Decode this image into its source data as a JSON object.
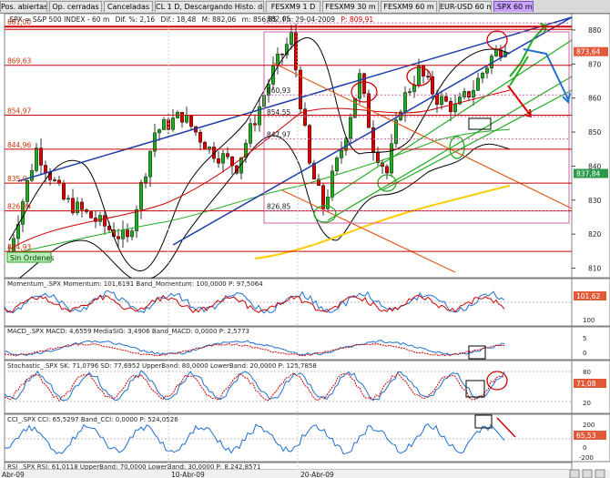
{
  "tabs": [
    "Pos. abiertas",
    "Op. cerradas",
    "Canceladas",
    "CL 1 D, Descargando Histo. de [CL]",
    "FESXM9 1 D",
    "FESXM9 30 m",
    "FESXM9 60 m",
    "EUR-USD 60 m",
    ".SPX 60 m"
  ],
  "main_header": {
    "symbol": ".SPX = S&P 500 INDEX - 60 m",
    "dif": "Dif. %: 2,16",
    "dif_abs": "Dif.: 18,48",
    "max": "M: 882,06",
    "min": "m: 856,85",
    "fecha": "Fh: 29-04-2009",
    "precio": "P: 809,91"
  },
  "price_labels": [
    {
      "text": "881,00",
      "value": 881,
      "color": "#cc0000"
    },
    {
      "text": "869,63",
      "value": 869.63,
      "color": "#cc0000"
    },
    {
      "text": "854,97",
      "value": 854.97,
      "color": "#cc0000"
    },
    {
      "text": "844,96",
      "value": 844.96,
      "color": "#cc0000"
    },
    {
      "text": "835,0",
      "value": 835,
      "color": "#cc0000"
    },
    {
      "text": "826,84",
      "value": 826.84,
      "color": "#cc0000"
    },
    {
      "text": "814,93",
      "value": 814.93,
      "color": "#cc0000"
    }
  ],
  "box_labels": [
    {
      "text": "882,05",
      "value": 882.05
    },
    {
      "text": "860,93",
      "value": 860.93
    },
    {
      "text": "854,55",
      "value": 854.55
    },
    {
      "text": "847,97",
      "value": 847.97
    },
    {
      "text": "826,85",
      "value": 826.85
    }
  ],
  "price_axis": {
    "ticks": [
      880,
      870,
      860,
      850,
      840,
      830,
      820,
      810
    ],
    "ylim": [
      808,
      884
    ],
    "last": "873,64",
    "last_value": 873.64,
    "second": "837,84",
    "second_value": 837.84
  },
  "sin_ordenes": "Sin Órdenes",
  "x_axis": {
    "labels": [
      "Abr-09",
      "10-Abr-09",
      "20-Abr-09"
    ]
  },
  "indicators": [
    {
      "id": "momentum",
      "title": "Momentum_.SPX Momentum: 101,6191 Band_Momentum: 100,0000 P: 97,5064",
      "ticks": [
        "100"
      ],
      "badge": "101,62",
      "badge_color": "#e05a3a"
    },
    {
      "id": "macd",
      "title": "MACD_.SPX MACD: 4,6559 MediaSIG: 3,4906 Band_MACD: 0,0000 P: 2,5773",
      "ticks": [
        "5",
        "0"
      ],
      "badge": "",
      "badge_color": "#e05a3a"
    },
    {
      "id": "stoch",
      "title": "Stochastic_.SPX SK: 71,0796 SD: 77,6952 UpperBand: 80,0000 LowerBand: 20,0000 P: 125,7858",
      "ticks": [
        "80",
        "20"
      ],
      "badge": "71,08",
      "badge_color": "#e05a3a"
    },
    {
      "id": "cci",
      "title": "CCI_.SPX CCI: 65,5297 Band_CCI: 0,0000 P: 524,0526",
      "ticks": [
        "200",
        "0",
        "-200"
      ],
      "badge": "65,53",
      "badge_color": "#e05a3a"
    }
  ],
  "rsi_title": "RSI_.SPX RSI: 61,0118 UpperBand: 70,0000 LowerBand: 30,0000 P: 8.242,8571",
  "colors": {
    "up": "#22aa22",
    "down": "#dd0000",
    "border": "#808080",
    "axis_bg": "#ffffff",
    "accent": "#c9a3ff"
  }
}
